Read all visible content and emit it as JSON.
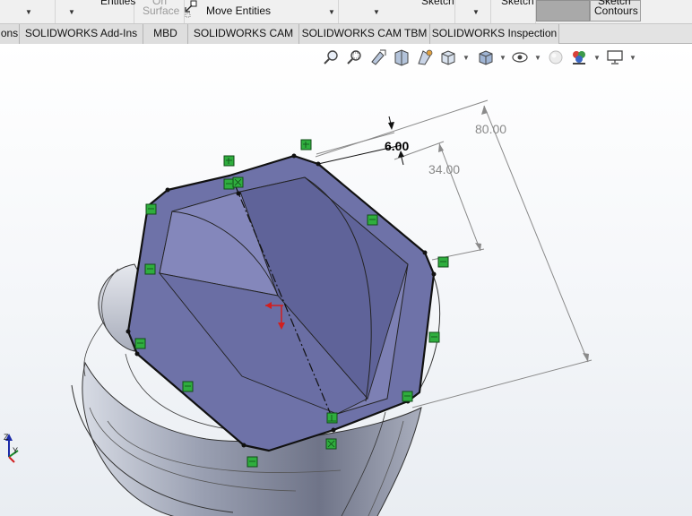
{
  "ribbon": {
    "entities_label": "Entities",
    "offset_surface_line1": "On",
    "offset_surface_line2": "Surface",
    "move_entities_label": "Move Entities",
    "sketch_label_1": "Sketch",
    "sketch_label_2": "Sketch",
    "sketch_contours_line1": "Sketch",
    "sketch_contours_line2": "Contours"
  },
  "tabs": [
    {
      "label": "ons"
    },
    {
      "label": "SOLIDWORKS Add-Ins"
    },
    {
      "label": "MBD"
    },
    {
      "label": "SOLIDWORKS CAM"
    },
    {
      "label": "SOLIDWORKS CAM TBM"
    },
    {
      "label": "SOLIDWORKS Inspection"
    }
  ],
  "view_toolbar": {
    "icons": [
      "zoom-to-fit-icon",
      "zoom-to-area-icon",
      "previous-view-icon",
      "section-view-icon",
      "dynamic-annotation-icon",
      "view-orientation-icon",
      "display-style-icon",
      "hide-show-items-icon",
      "edit-appearance-icon",
      "apply-scene-icon",
      "view-settings-icon"
    ]
  },
  "dimensions": {
    "overall": "80.00",
    "thickness": "6.00",
    "inner": "34.00"
  },
  "triad": {
    "z_label": "Z",
    "y_label": "Y"
  },
  "colors": {
    "sketch_face": "#6e72a8",
    "relation_marker": "#2fae3e",
    "dimension_gray": "#8a8a8a",
    "origin_red": "#d11f1f"
  }
}
